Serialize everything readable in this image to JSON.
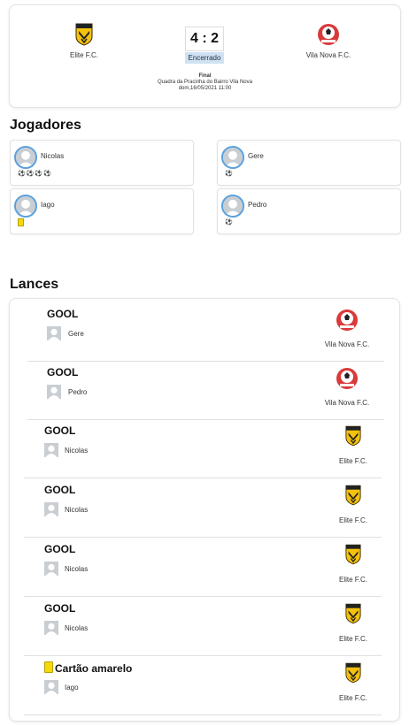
{
  "match": {
    "home": {
      "name": "Elite F.C."
    },
    "away": {
      "name": "Vila Nova F.C."
    },
    "score": "4 : 2",
    "status": "Encerrado",
    "stage": "Final",
    "venue": "Quadra da Pracinha do Bairro Vila Nova",
    "datetime": "dom,16/05/2021 11:00"
  },
  "players_section": {
    "title": "Jogadores"
  },
  "players": [
    {
      "name": "Nicolas",
      "events": "⚽⚽⚽⚽"
    },
    {
      "name": "Gere",
      "events": "⚽"
    },
    {
      "name": "Iago",
      "events": ""
    },
    {
      "name": "Pedro",
      "events": "⚽"
    }
  ],
  "events_section": {
    "title": "Lances"
  },
  "events": [
    {
      "type": "GOOL",
      "player": "Gere",
      "team": "Vila Nova F.C."
    },
    {
      "type": "GOOL",
      "player": "Pedro",
      "team": "Vila Nova F.C."
    },
    {
      "type": "GOOL",
      "player": "Nicolas",
      "team": "Elite F.C."
    },
    {
      "type": "GOOL",
      "player": "Nicolas",
      "team": "Elite F.C."
    },
    {
      "type": "GOOL",
      "player": "Nicolas",
      "team": "Elite F.C."
    },
    {
      "type": "GOOL",
      "player": "Nicolas",
      "team": "Elite F.C."
    },
    {
      "type": "Cartão amarelo",
      "player": "Iago",
      "team": "Elite F.C."
    }
  ],
  "colors": {
    "accent": "#5aa0dd",
    "status_bg": "#cfe2f3",
    "yellow_card": "#f5d90a"
  }
}
